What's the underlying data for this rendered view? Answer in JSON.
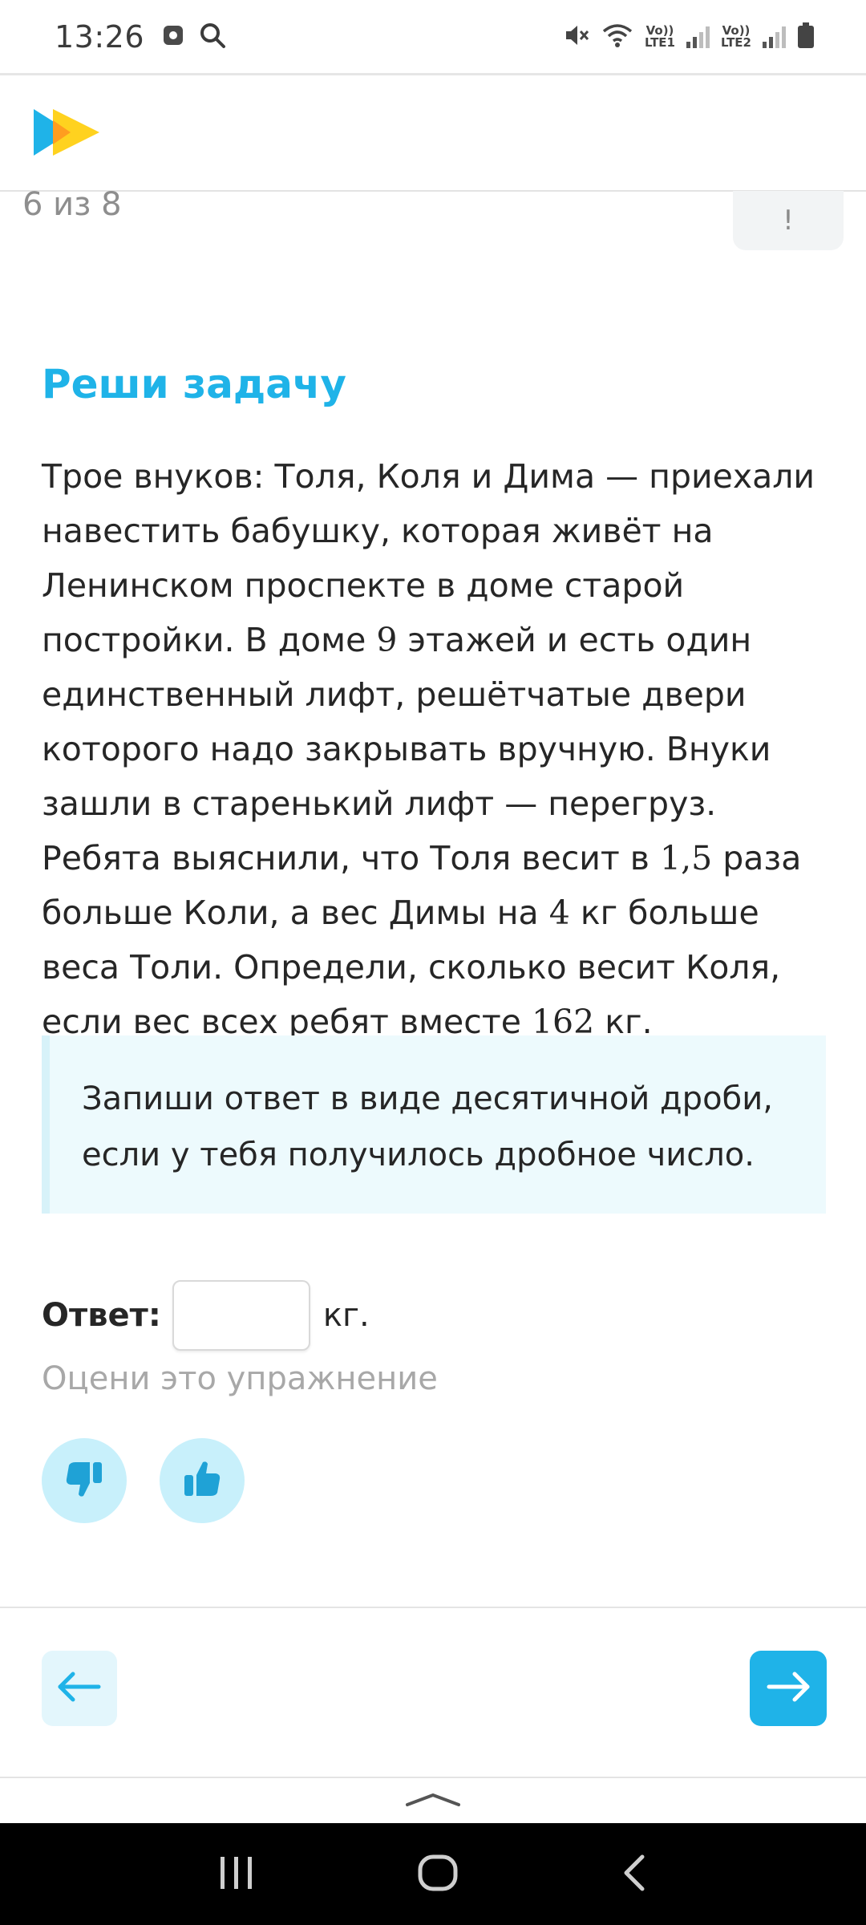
{
  "status_bar": {
    "time": "13:26",
    "sim1": "Vo))\nLTE1",
    "sim2": "Vo))\nLTE2"
  },
  "progress": {
    "text": "6 из 8",
    "report_label": "!"
  },
  "task": {
    "title": "Реши задачу",
    "text_parts": {
      "p1": "Трое внуков: Толя, Коля и Дима — приехали навестить бабушку, которая живёт на Ленинском проспекте в доме старой постройки. В доме ",
      "n1": "9",
      "p2": " этажей и есть один единственный лифт, решётчатые двери которого надо закрывать вручную. Внуки зашли в старенький лифт — перегруз. Ребята выяснили, что Толя весит в ",
      "n2": "1,5",
      "p3": " раза больше Коли, а вес Димы на ",
      "n3": "4",
      "p4": " кг больше веса Толи. Определи, сколько весит Коля, если вес всех ребят вместе ",
      "n4": "162",
      "p5": " кг."
    }
  },
  "hint": {
    "text": "Запиши ответ в виде десятичной дроби, если у тебя получилось дробное число."
  },
  "answer": {
    "label": "Ответ:",
    "value": "",
    "unit": "кг."
  },
  "rating": {
    "prompt": "Оцени это упражнение"
  },
  "colors": {
    "accent": "#1fb3e8",
    "accent_light": "#c8f0fb",
    "hint_bg": "#edfafd"
  },
  "icons": {
    "logo": "play-logo-icon",
    "dislike": "thumbs-down-icon",
    "like": "thumbs-up-icon",
    "back": "arrow-left-icon",
    "next": "arrow-right-icon"
  }
}
